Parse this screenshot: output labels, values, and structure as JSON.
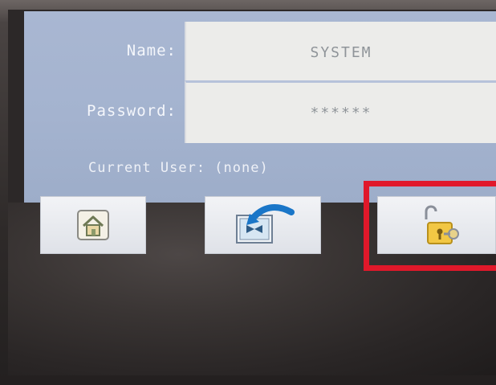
{
  "login": {
    "name_label": "Name:",
    "name_value": "SYSTEM",
    "password_label": "Password:",
    "password_value": "******",
    "current_user_text": "Current User: (none)"
  },
  "buttons": [
    {
      "name": "home",
      "icon": "home-icon"
    },
    {
      "name": "transfer",
      "icon": "transfer-icon"
    },
    {
      "name": "lock",
      "icon": "padlock-key-icon"
    }
  ],
  "colors": {
    "panel_bg": "#a9b7d2",
    "field_bg": "#ececea",
    "highlight": "#e0182a",
    "arrow_blue": "#1a76c8",
    "lock_yellow": "#f2c744"
  }
}
